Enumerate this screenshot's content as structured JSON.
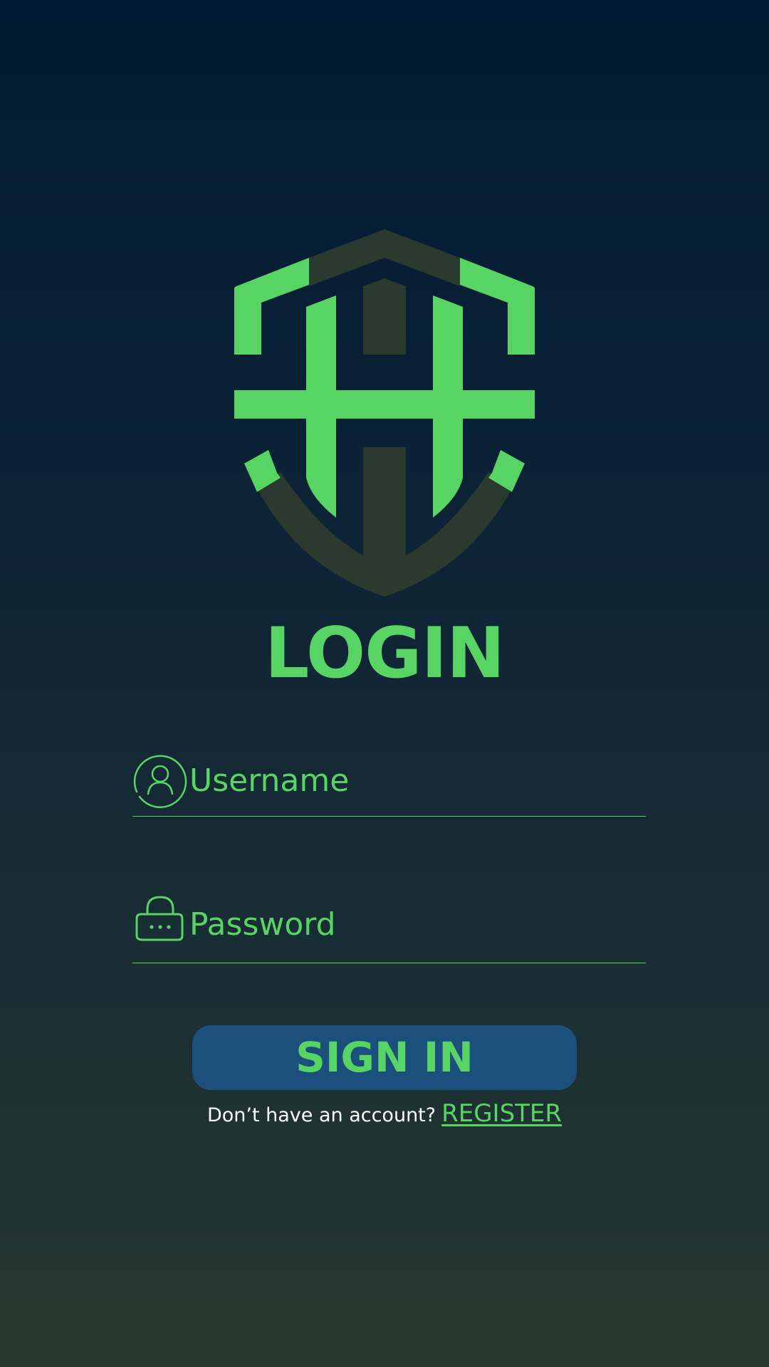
{
  "colors": {
    "accent": "#58d464",
    "shield_dark": "#2b3a2e",
    "button_bg": "#1b4f7c",
    "bg_top": "#011934",
    "bg_bottom": "#27382e"
  },
  "logo": {
    "icon": "shield-logo-icon"
  },
  "title": "LOGIN",
  "username": {
    "placeholder": "Username",
    "value": "",
    "icon": "user-icon"
  },
  "password": {
    "placeholder": "Password",
    "value": "",
    "icon": "lock-icon"
  },
  "signin_label": "SIGN IN",
  "register": {
    "prompt": "Don’t have an account?",
    "link": "REGISTER"
  }
}
